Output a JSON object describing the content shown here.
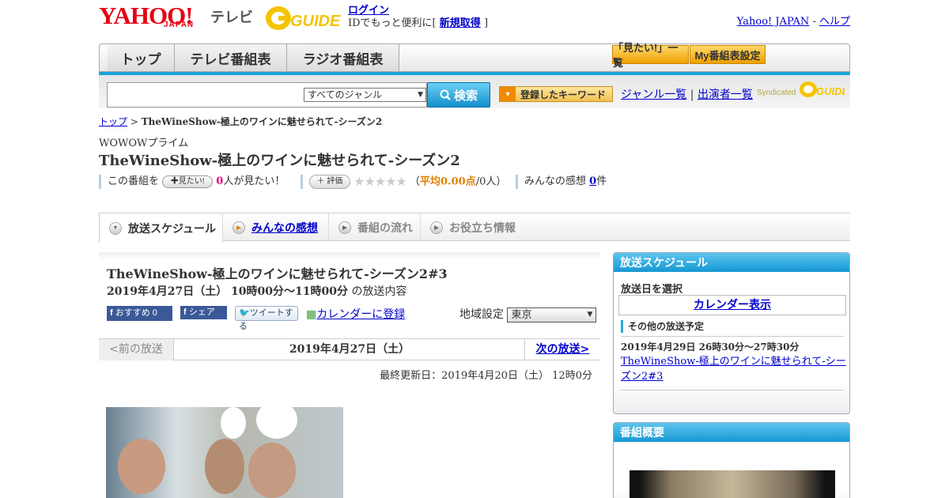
{
  "header": {
    "logo": "YAHOO!",
    "logo_sub": "JAPAN",
    "service": "テレビ",
    "gguide": "GUIDE",
    "login": "ログイン",
    "login_msg_pre": "IDでもっと便利に[",
    "signup": "新規取得",
    "login_msg_post": "]",
    "yahoo_japan": "Yahoo! JAPAN",
    "sep": "-",
    "help": "ヘルプ"
  },
  "nav": {
    "tabs": [
      "トップ",
      "テレビ番組表",
      "ラジオ番組表"
    ],
    "mitai_list": "「見たい!」一覧",
    "my_bangumi": "My番組表設定"
  },
  "search": {
    "genre_selected": "すべてのジャンル",
    "button": "検索",
    "keyword_button": "登録したキーワード",
    "genre_list": "ジャンル一覧",
    "divider": "|",
    "performer_list": "出演者一覧",
    "syndicated": "Syndicated"
  },
  "breadcrumb": {
    "top": "トップ",
    "sep": ">",
    "current": "TheWineShow-極上のワインに魅せられて-シーズン2"
  },
  "program": {
    "channel": "WOWOWプライム",
    "title": "TheWineShow-極上のワインに魅せられて-シーズン2",
    "kono": "この番組を",
    "mitai_btn": "見たい!",
    "mitai_count": "0",
    "mitai_suffix": "人が見たい！",
    "hyoka_btn": "評価",
    "stars": "★★★★★",
    "avg_pre": "（",
    "avg": "平均0.00点",
    "avg_post": "/0人）",
    "kansou_label": "みんなの感想",
    "kansou_count": "0",
    "kansou_suffix": "件"
  },
  "tabs": [
    "放送スケジュール",
    "みんなの感想",
    "番組の流れ",
    "お役立ち情報"
  ],
  "episode": {
    "title": "TheWineShow-極上のワインに魅せられて-シーズン2#3",
    "date_time": "2019年4月27日（土） 10時00分～11時00分",
    "date_suffix": "の放送内容",
    "fb_recommend": "おすすめ",
    "fb_recommend_count": "0",
    "fb_share": "シェア",
    "tweet": "ツイートする",
    "calendar_add": "カレンダーに登録",
    "region_label": "地域設定",
    "region_value": "東京"
  },
  "pager": {
    "prev": "<前の放送",
    "date": "2019年4月27日（土）",
    "next": "次の放送>"
  },
  "updated": "最終更新日：2019年4月20日（土） 12時0分",
  "sidebar": {
    "schedule_title": "放送スケジュール",
    "select_date": "放送日を選択",
    "calendar_show": "カレンダー表示",
    "other_broadcasts": "その他の放送予定",
    "other_date": "2019年4月29日 26時30分～27時30分",
    "other_link": "TheWineShow-極上のワインに魅せられて-シーズン2#3",
    "overview_title": "番組概要"
  }
}
